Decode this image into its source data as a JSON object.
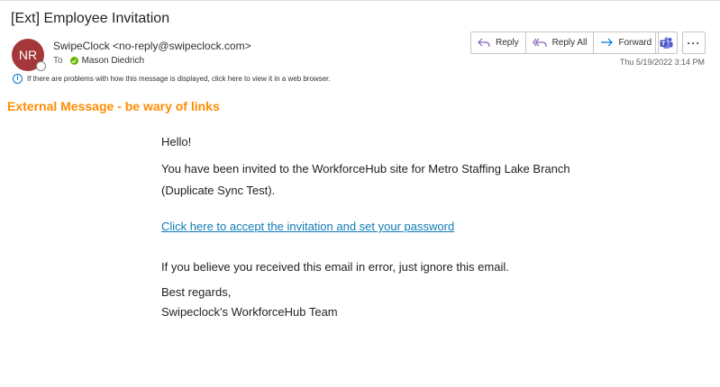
{
  "email": {
    "subject": "[Ext] Employee Invitation",
    "sender_initials": "NR",
    "sender": "SwipeClock <no-reply@swipeclock.com>",
    "to_label": "To",
    "recipient": "Mason Diedrich",
    "date": "Thu 5/19/2022 3:14 PM",
    "info_message": "If there are problems with how this message is displayed, click here to view it in a web browser."
  },
  "actions": {
    "reply": "Reply",
    "reply_all": "Reply All",
    "forward": "Forward",
    "more": "···"
  },
  "banner": "External Message - be wary of links",
  "body": {
    "greeting": "Hello!",
    "line1": "You have been invited to the WorkforceHub site for Metro Staffing Lake Branch",
    "line2": "(Duplicate Sync Test).",
    "link": "Click here to accept the invitation and set your password",
    "error_note": "If you believe you received this email in error, just ignore this email.",
    "closing": "Best regards,",
    "signature": "Swipeclock's WorkforceHub Team"
  },
  "colors": {
    "avatar": "#a4373a",
    "banner": "#ff8c00",
    "link": "#0f7bb6",
    "accent": "#0078d4"
  }
}
